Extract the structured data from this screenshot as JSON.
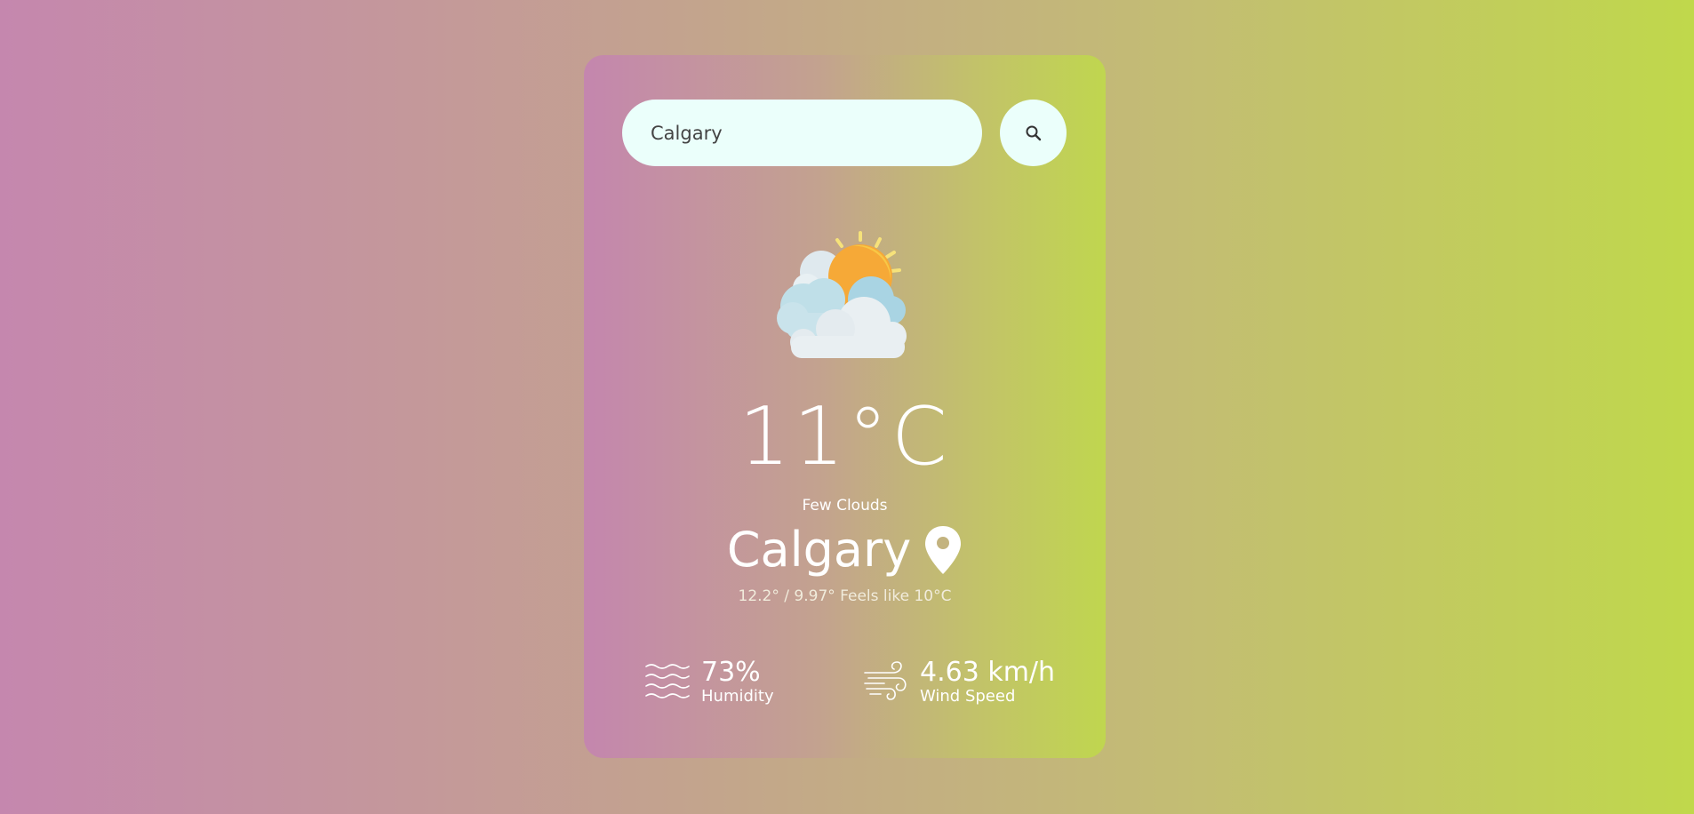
{
  "search": {
    "value": "Calgary",
    "button_icon": "search-icon"
  },
  "weather": {
    "icon": "sun-behind-clouds-icon",
    "temperature": "11°C",
    "description": "Few Clouds",
    "city": "Calgary",
    "location_icon": "map-pin-icon",
    "temp_range": "12.2° / 9.97° Feels like 10°C"
  },
  "stats": {
    "humidity": {
      "value": "73%",
      "label": "Humidity",
      "icon": "humidity-waves-icon"
    },
    "wind": {
      "value": "4.63 km/h",
      "label": "Wind Speed",
      "icon": "wind-icon"
    }
  },
  "colors": {
    "background_left": "#c587ae",
    "background_right": "#c0d84b",
    "input_background": "#ebfffb",
    "text": "#ffffff"
  }
}
